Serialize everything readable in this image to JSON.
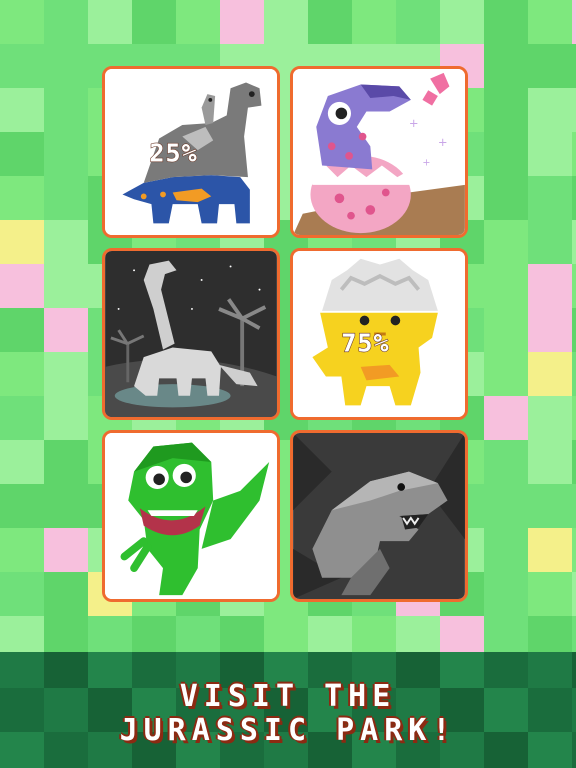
{
  "caption": {
    "line1": "VISIT THE",
    "line2": "JURASSIC PARK!"
  },
  "tiles": [
    {
      "id": "brachiosaurus-gray",
      "progress_label": "25%",
      "progress": 0.25
    },
    {
      "id": "baby-dino-egg",
      "progress_label": "",
      "progress": 1.0
    },
    {
      "id": "brachiosaurus-night",
      "progress_label": "",
      "progress": 1.0
    },
    {
      "id": "yellow-triceratops",
      "progress_label": "75%",
      "progress": 0.75
    },
    {
      "id": "green-trex",
      "progress_label": "",
      "progress": 1.0
    },
    {
      "id": "trex-dark",
      "progress_label": "",
      "progress": 1.0
    }
  ],
  "colors": {
    "background_green": "#7ee87e",
    "tile_border": "#ef6b2f",
    "banner": "#1f7a45",
    "caption_shadow": "#8b2a12"
  }
}
